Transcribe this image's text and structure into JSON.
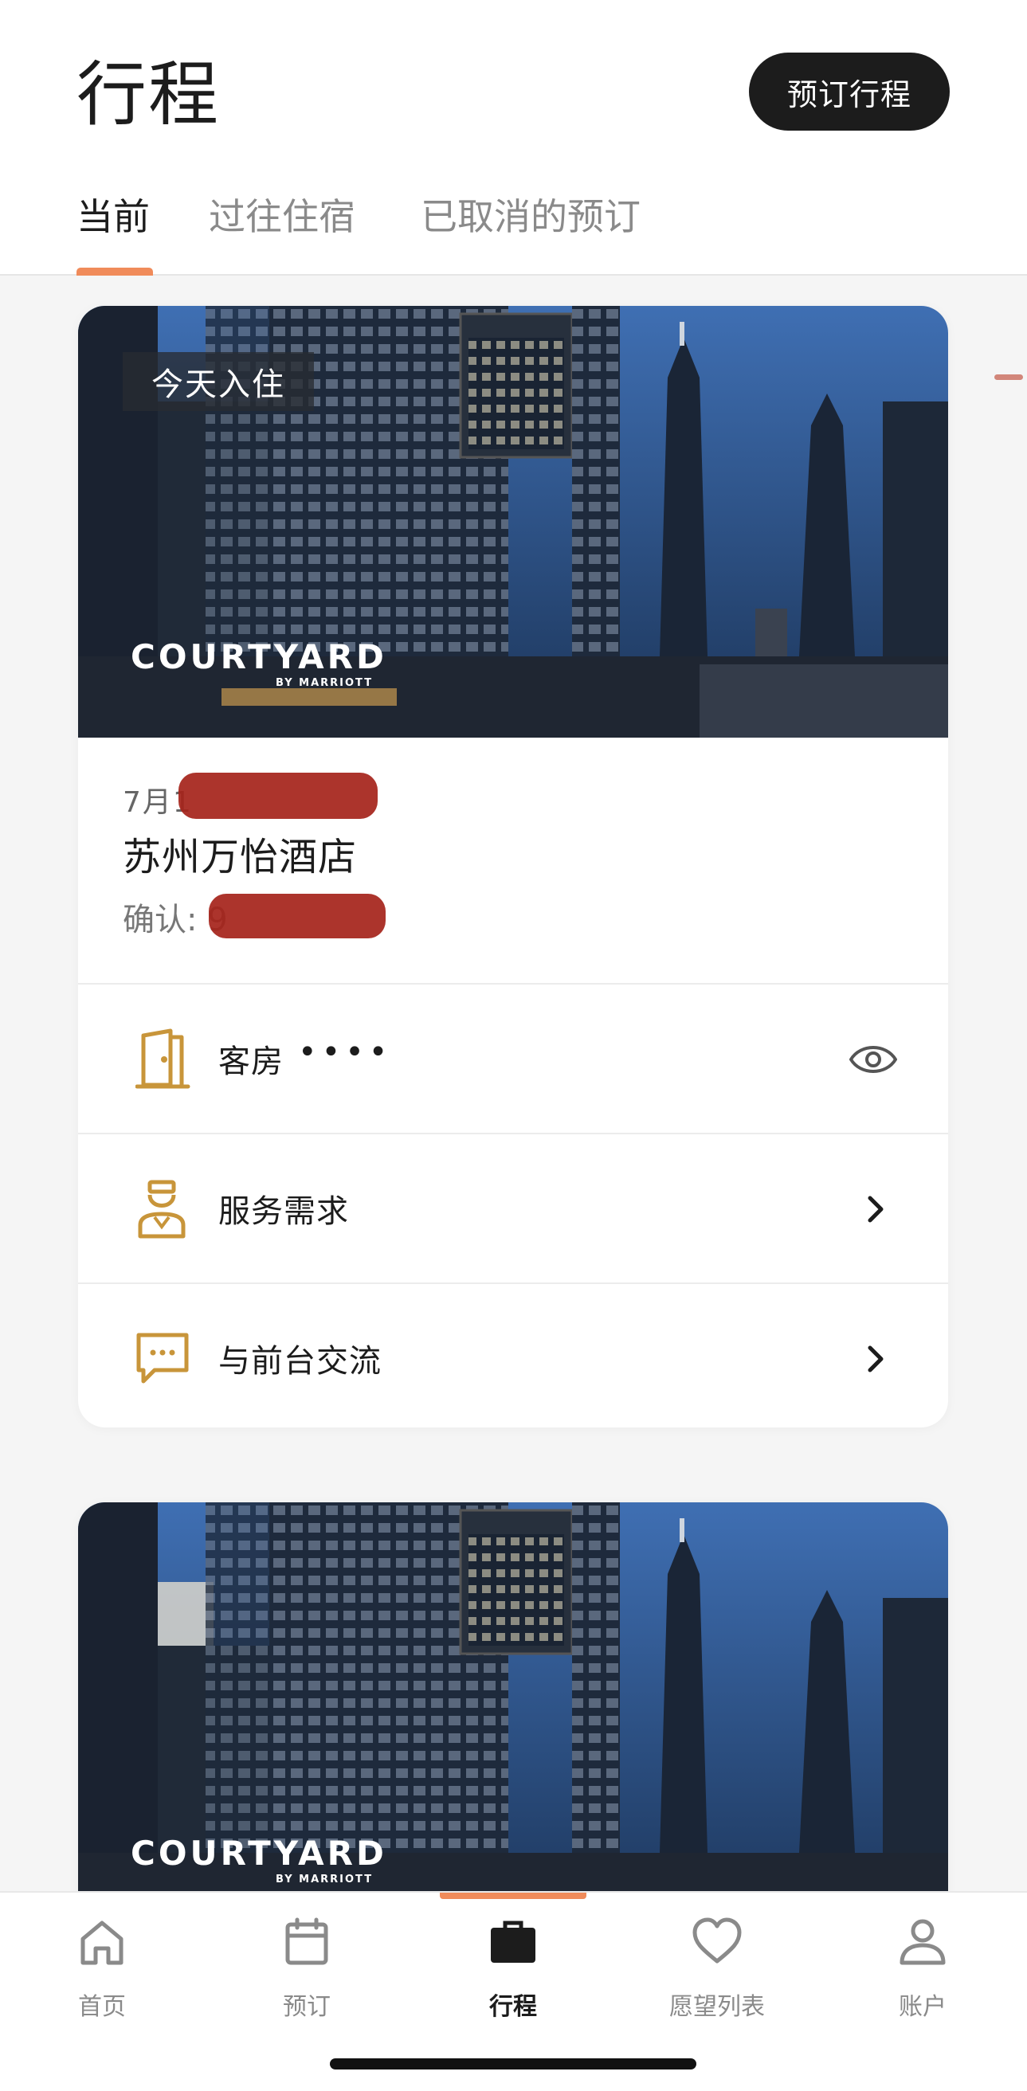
{
  "header": {
    "title": "行程",
    "book_button": "预订行程"
  },
  "tabs": [
    {
      "label": "当前",
      "active": true
    },
    {
      "label": "过往住宿",
      "active": false
    },
    {
      "label": "已取消的预订",
      "active": false
    }
  ],
  "trips": [
    {
      "badge": "今天入住",
      "brand": "COURTYARD",
      "brand_sub": "BY MARRIOTT",
      "date": "7月1",
      "hotel_name": "苏州万怡酒店",
      "confirmation_label": "确认: 9",
      "actions": [
        {
          "label": "客房",
          "masked_value": "••••",
          "icon": "door-icon",
          "end_icon": "eye-icon"
        },
        {
          "label": "服务需求",
          "icon": "concierge-icon",
          "end_icon": "chevron-right-icon"
        },
        {
          "label": "与前台交流",
          "icon": "chat-bubble-icon",
          "end_icon": "chevron-right-icon"
        }
      ]
    },
    {
      "brand": "COURTYARD",
      "brand_sub": "BY MARRIOTT"
    }
  ],
  "bottom_nav": [
    {
      "label": "首页",
      "icon": "home-icon",
      "active": false
    },
    {
      "label": "预订",
      "icon": "calendar-icon",
      "active": false
    },
    {
      "label": "行程",
      "icon": "briefcase-icon",
      "active": true
    },
    {
      "label": "愿望列表",
      "icon": "heart-icon",
      "active": false
    },
    {
      "label": "账户",
      "icon": "person-icon",
      "active": false
    }
  ],
  "colors": {
    "accent": "#f08b5a",
    "icon_gold": "#c8953a",
    "dark": "#1c1c1c",
    "muted": "#8a8a8a"
  }
}
